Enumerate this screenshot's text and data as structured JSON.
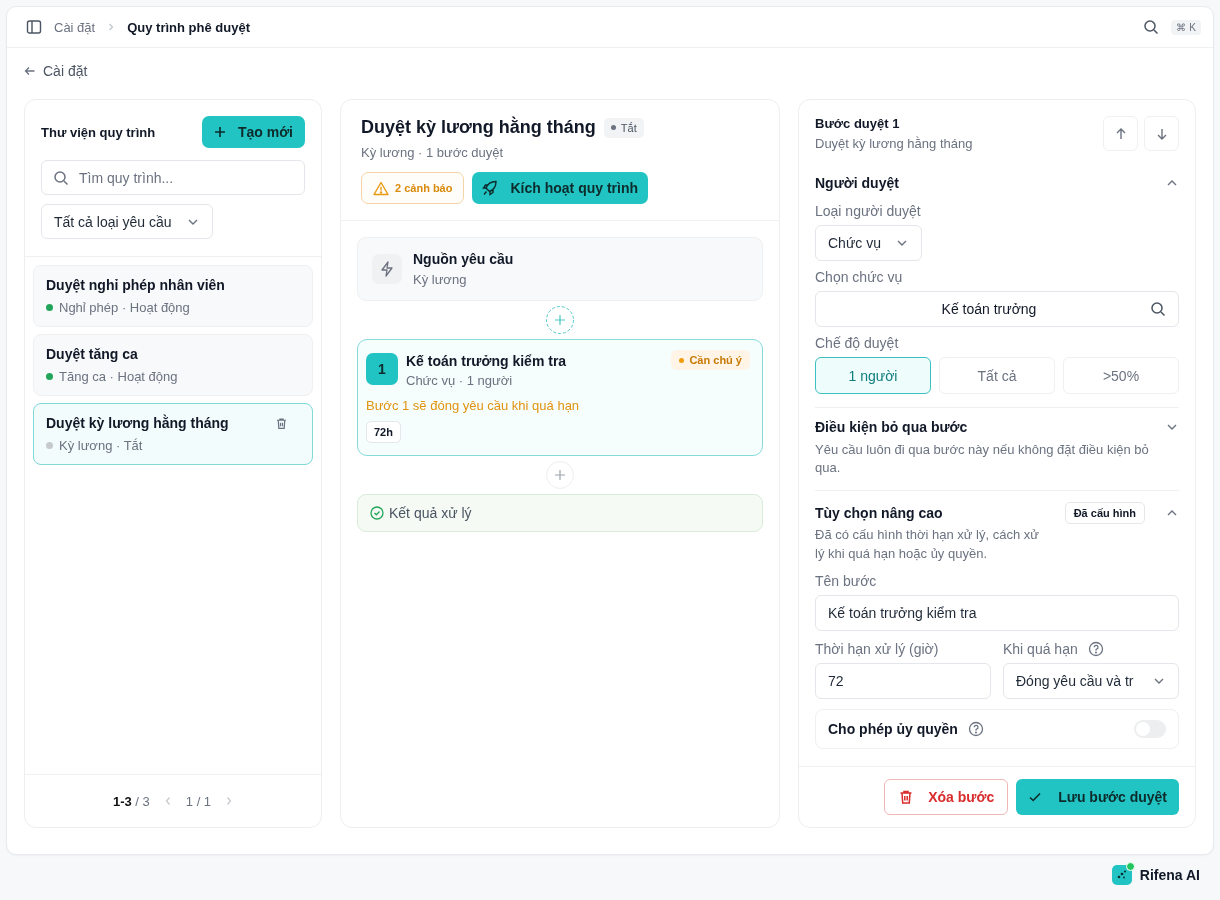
{
  "header": {
    "breadcrumb": [
      "Cài đặt",
      "Quy trình phê duyệt"
    ],
    "shortcut_keys": [
      "⌘",
      "K"
    ]
  },
  "back_link": "Cài đặt",
  "library": {
    "title": "Thư viện quy trình",
    "create_button": "Tạo mới",
    "search": {
      "placeholder": "Tìm quy trình..."
    },
    "filter": "Tất cả loại yêu cầu",
    "items": [
      {
        "title": "Duyệt nghỉ phép nhân viên",
        "meta": "Nghỉ phép · Hoạt động",
        "color": "#22a55a",
        "selected": false
      },
      {
        "title": "Duyệt tăng ca",
        "meta": "Tăng ca · Hoạt động",
        "color": "#22a55a",
        "selected": false
      },
      {
        "title": "Duyệt kỳ lương hằng tháng",
        "meta": "Kỳ lương · Tắt",
        "color": "#c6cacf",
        "selected": true
      }
    ],
    "pagination": {
      "range": "1-3",
      "total": "/ 3",
      "page": "1 / 1"
    }
  },
  "workflow": {
    "title": "Duyệt kỳ lương hằng tháng",
    "status": "Tắt",
    "subtitle": "Kỳ lương · 1 bước duyệt",
    "warnings_button": "2 cảnh báo",
    "activate_button": "Kích hoạt quy trình",
    "source": {
      "title": "Nguồn yêu cầu",
      "subtitle": "Kỳ lương"
    },
    "steps": [
      {
        "number": "1",
        "title": "Kế toán trưởng kiểm tra",
        "meta": "Chức vụ · 1 người",
        "badge": "Cần chú ý",
        "warning": "Bước 1 sẽ đóng yêu cầu khi quá hạn",
        "duration": "72h",
        "selected": true
      }
    ],
    "result": "Kết quả xử lý"
  },
  "step_editor": {
    "title": "Bước duyệt 1",
    "subtitle": "Duyệt kỳ lương hằng tháng",
    "approver": {
      "title": "Người duyệt",
      "expanded": true,
      "type_label": "Loại người duyệt",
      "type_value": "Chức vụ",
      "position_label": "Chọn chức vụ",
      "position_value": "Kế toán trưởng",
      "mode_label": "Chế độ duyệt",
      "modes": [
        {
          "label": "1 người",
          "selected": true
        },
        {
          "label": "Tất cả",
          "selected": false
        },
        {
          "label": ">50%",
          "selected": false
        }
      ]
    },
    "skip": {
      "title": "Điều kiện bỏ qua bước",
      "expanded": false,
      "description": "Yêu cầu luôn đi qua bước này nếu không đặt điều kiện bỏ qua."
    },
    "advanced": {
      "title": "Tùy chọn nâng cao",
      "expanded": true,
      "badge": "Đã cấu hình",
      "description": "Đã có cấu hình thời hạn xử lý, cách xử lý khi quá hạn hoặc ủy quyền.",
      "name_label": "Tên bước",
      "name_value": "Kế toán trưởng kiểm tra",
      "deadline_label": "Thời hạn xử lý (giờ)",
      "deadline_value": "72",
      "overdue_label": "Khi quá hạn",
      "overdue_value": "Đóng yêu cầu và tr",
      "delegation": {
        "label": "Cho phép ủy quyền",
        "on": false
      }
    },
    "delete_button": "Xóa bước",
    "save_button": "Lưu bước duyệt"
  },
  "assistant": "Rifena AI"
}
